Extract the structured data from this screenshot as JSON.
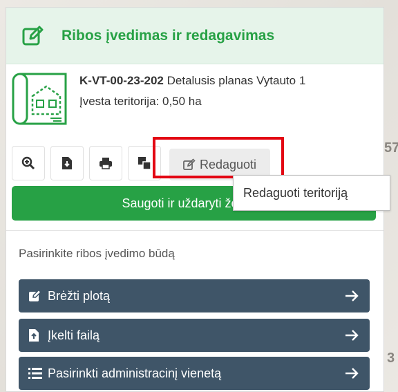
{
  "header": {
    "title": "Ribos įvedimas ir redagavimas",
    "icon": "edit-square-icon"
  },
  "plan": {
    "code": "K-VT-00-23-202",
    "name": "Detalusis planas Vytauto 1",
    "area_label": "Įvesta teritorija: 0,50 ha",
    "icon": "blueprint-icon"
  },
  "toolbar": {
    "icons": [
      "zoom-in-icon",
      "file-download-icon",
      "print-icon",
      "copy-icon"
    ],
    "edit_label": "Redaguoti"
  },
  "save_button": {
    "label": "Saugoti ir uždaryti že"
  },
  "tooltip": {
    "text": "Redaguoti teritoriją"
  },
  "method": {
    "prompt": "Pasirinkite ribos įvedimo būdą",
    "options": [
      {
        "label": "Brėžti plotą",
        "icon": "draw-icon"
      },
      {
        "label": "Įkelti failą",
        "icon": "file-upload-icon"
      },
      {
        "label": "Pasirinkti administracinį vienetą",
        "icon": "list-icon"
      }
    ]
  },
  "map": {
    "labels": [
      "57",
      "3"
    ]
  },
  "colors": {
    "accent_green": "#27a145",
    "header_bg": "#e6f4ea",
    "method_bg": "#3f5568",
    "highlight": "#e30613"
  }
}
